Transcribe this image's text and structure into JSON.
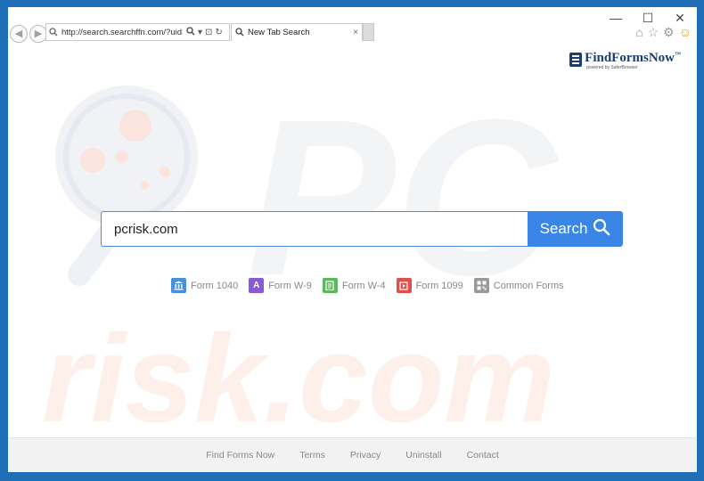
{
  "browser": {
    "url": "http://search.searchffn.com/?uid=!",
    "tab_title": "New Tab Search",
    "tab_close": "×",
    "controls": {
      "minimize": "—",
      "maximize": "☐",
      "close": "✕"
    },
    "toolbar_icons": [
      "home-icon",
      "star-icon",
      "gear-icon",
      "smiley-icon"
    ]
  },
  "logo": {
    "name": "FindFormsNow",
    "trademark": "™",
    "tagline": "powered by SaferBrowser"
  },
  "watermark": {
    "text": "risk.com",
    "brand_letters": "PC"
  },
  "search": {
    "value": "pcrisk.com",
    "button_label": "Search"
  },
  "quick_links": [
    {
      "label": "Form 1040",
      "icon": "bank-icon",
      "color": "#4a90d9"
    },
    {
      "label": "Form W-9",
      "icon": "letter-a-icon",
      "color": "#8a5ad6"
    },
    {
      "label": "Form W-4",
      "icon": "clipboard-icon",
      "color": "#5cb85c"
    },
    {
      "label": "Form 1099",
      "icon": "document-icon",
      "color": "#e0504a"
    },
    {
      "label": "Common Forms",
      "icon": "qr-code-icon",
      "color": "#9a9a9a"
    }
  ],
  "footer": {
    "links": [
      "Find Forms Now",
      "Terms",
      "Privacy",
      "Uninstall",
      "Contact"
    ]
  },
  "colors": {
    "frame": "#1e6fb8",
    "search_button": "#3a86e6",
    "search_border": "#4a8ae0",
    "logo": "#1c3e6e"
  }
}
